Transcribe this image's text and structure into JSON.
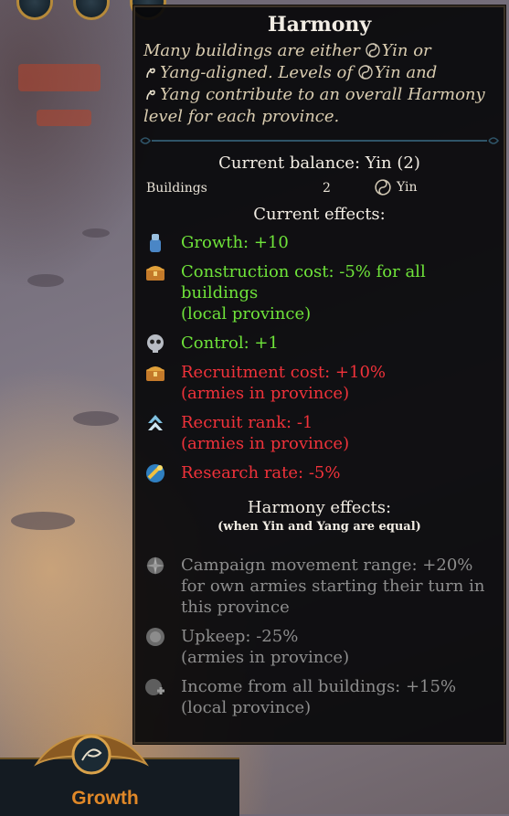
{
  "tooltip": {
    "title": "Harmony",
    "description": {
      "part1": "Many buildings are either ",
      "yin1": "Yin",
      "part2": " or",
      "yang1": "Yang",
      "part3": "-aligned. Levels of ",
      "yin2": "Yin",
      "part4": " and",
      "yang2": "Yang",
      "part5": " contribute to an overall Harmony level for each province."
    },
    "current_balance": "Current balance: Yin (2)",
    "buildings_row": {
      "label": "Buildings",
      "count": "2",
      "alignment": "Yin"
    },
    "current_effects_header": "Current effects:",
    "current_effects": [
      {
        "icon": "growth-icon",
        "tone": "pos",
        "lines": [
          "Growth: +10"
        ]
      },
      {
        "icon": "chest-icon",
        "tone": "pos",
        "lines": [
          "Construction cost: -5% for all",
          "buildings",
          "(local province)"
        ]
      },
      {
        "icon": "skull-icon",
        "tone": "pos",
        "lines": [
          "Control: +1"
        ]
      },
      {
        "icon": "chest-icon",
        "tone": "neg",
        "lines": [
          "Recruitment cost: +10%",
          "(armies in province)"
        ]
      },
      {
        "icon": "rank-chevron-icon",
        "tone": "neg",
        "lines": [
          "Recruit rank: -1",
          "(armies in province)"
        ]
      },
      {
        "icon": "research-scroll-icon",
        "tone": "neg",
        "lines": [
          "Research rate: -5%"
        ]
      }
    ],
    "harmony_effects_header": "Harmony effects:",
    "harmony_effects_sub": "(when Yin and Yang are equal)",
    "harmony_effects": [
      {
        "icon": "compass-icon",
        "tone": "off",
        "lines": [
          "Campaign movement range: +20%",
          "for own armies starting their turn in",
          "this province"
        ]
      },
      {
        "icon": "coin-icon",
        "tone": "off",
        "lines": [
          "Upkeep: -25%",
          "(armies in province)"
        ]
      },
      {
        "icon": "income-icon",
        "tone": "off",
        "lines": [
          "Income from all buildings: +15%",
          "(local province)"
        ]
      }
    ]
  },
  "bottom_panel": {
    "label": "Growth"
  },
  "colors": {
    "positive": "#6fe43a",
    "negative": "#f0323a",
    "disabled": "#8d8d8d",
    "accent": "#e08828"
  }
}
